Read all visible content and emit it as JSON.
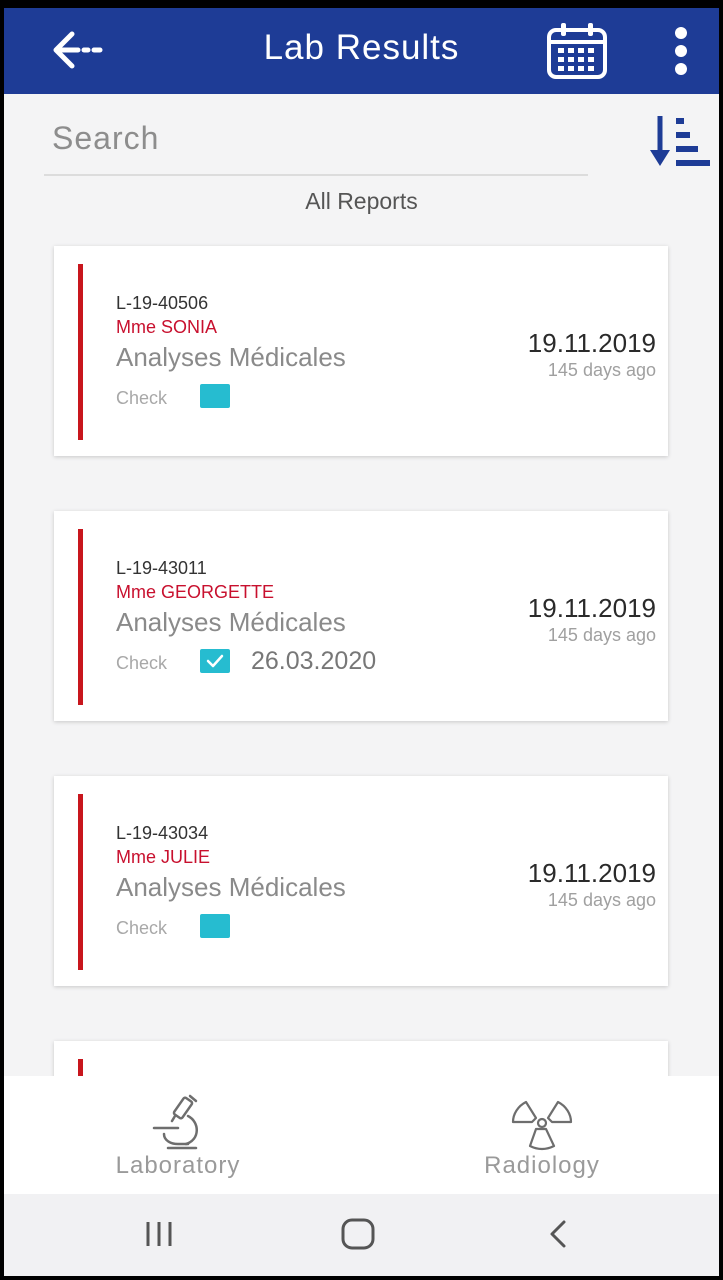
{
  "header": {
    "title": "Lab Results"
  },
  "search": {
    "placeholder": "Search"
  },
  "list_title": "All Reports",
  "reports": [
    {
      "code": "L-19-40506",
      "patient": "Mme SONIA",
      "type": "Analyses Médicales",
      "check_label": "Check",
      "checked": false,
      "check_date": "",
      "date": "19.11.2019",
      "ago": "145 days ago"
    },
    {
      "code": "L-19-43011",
      "patient": "Mme GEORGETTE",
      "type": "Analyses Médicales",
      "check_label": "Check",
      "checked": true,
      "check_date": "26.03.2020",
      "date": "19.11.2019",
      "ago": "145 days ago"
    },
    {
      "code": "L-19-43034",
      "patient": "Mme JULIE",
      "type": "Analyses Médicales",
      "check_label": "Check",
      "checked": false,
      "check_date": "",
      "date": "19.11.2019",
      "ago": "145 days ago"
    }
  ],
  "bottom_nav": {
    "laboratory": "Laboratory",
    "radiology": "Radiology"
  },
  "colors": {
    "appbar": "#1e3c96",
    "accent_bar": "#c8161d",
    "patient_name": "#c8102e",
    "checkbox": "#26bcd0"
  },
  "icons": {
    "back": "arrow-left-icon",
    "calendar": "calendar-icon",
    "menu": "more-vertical-icon",
    "sort": "sort-descending-icon",
    "laboratory": "microscope-icon",
    "radiology": "radiation-icon"
  }
}
